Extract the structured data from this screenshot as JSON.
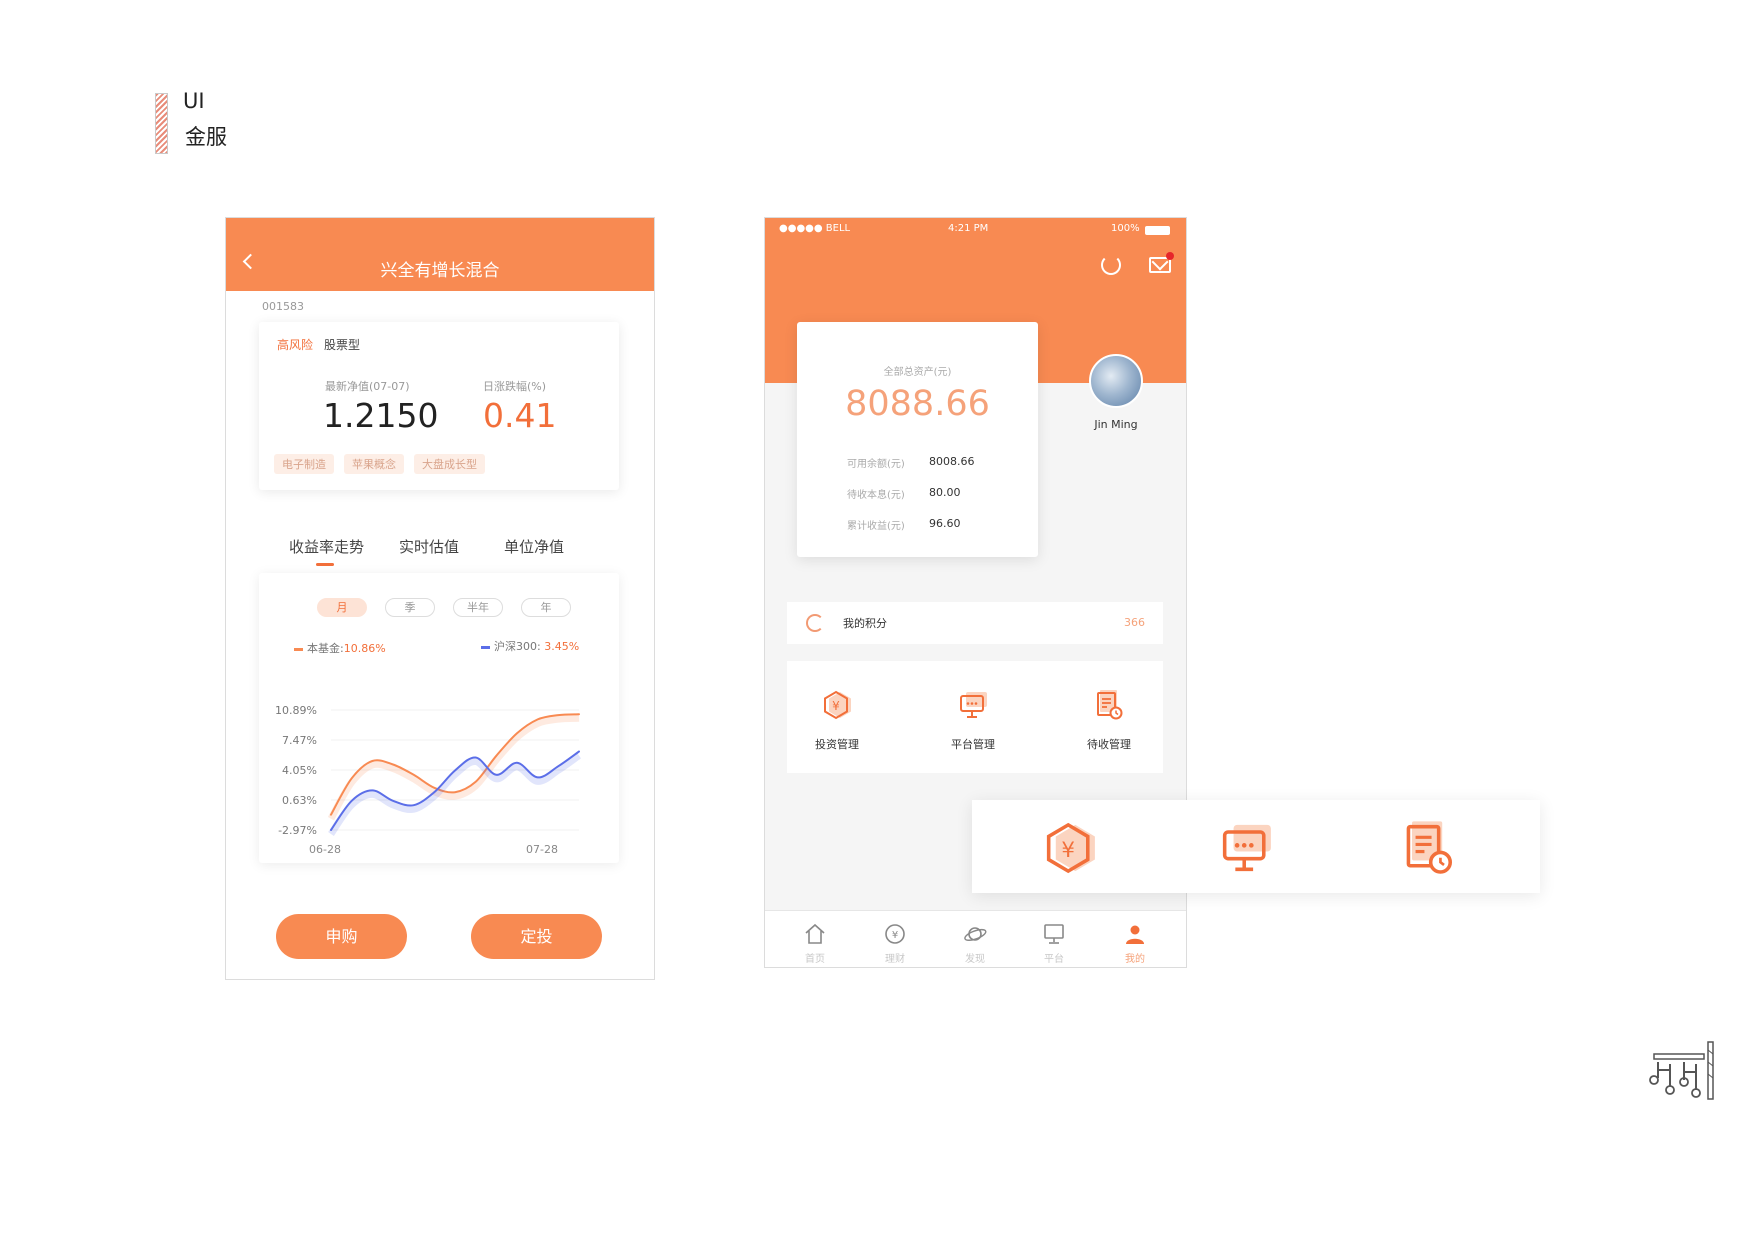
{
  "page": {
    "title": "UI",
    "subtitle": "金服"
  },
  "fund_screen": {
    "title": "兴全有增长混合",
    "fund_code": "001583",
    "risk_level": "高风险",
    "fund_type": "股票型",
    "nav_label": "最新净值(07-07)",
    "nav_value": "1.2150",
    "change_label": "日涨跌幅(%)",
    "change_value": "0.41",
    "tags": [
      "电子制造",
      "苹果概念",
      "大盘成长型"
    ],
    "tabs": [
      "收益率走势",
      "实时估值",
      "单位净值"
    ],
    "periods": [
      "月",
      "季",
      "半年",
      "年"
    ],
    "legend": {
      "fund_label": "本基金:",
      "fund_value": "10.86%",
      "index_label": "沪深300:",
      "index_value": "3.45%"
    },
    "buttons": {
      "subscribe": "申购",
      "auto_invest": "定投"
    }
  },
  "chart_data": {
    "type": "line",
    "x": [
      "06-28",
      "07-28"
    ],
    "y_ticks": [
      "10.89%",
      "7.47%",
      "4.05%",
      "0.63%",
      "-2.97%"
    ],
    "ylim": [
      -2.97,
      10.89
    ],
    "series": [
      {
        "name": "本基金",
        "color": "#f88a52",
        "values": [
          -1.2,
          3.0,
          5.0,
          4.6,
          3.4,
          1.9,
          1.4,
          2.6,
          5.6,
          8.2,
          9.8,
          10.3,
          10.4
        ]
      },
      {
        "name": "沪深300",
        "color": "#5b6ee8",
        "values": [
          -2.97,
          0.4,
          1.6,
          0.4,
          -0.1,
          1.4,
          3.9,
          5.4,
          3.4,
          4.8,
          3.1,
          4.4,
          6.1
        ]
      }
    ],
    "grid": true
  },
  "account_screen": {
    "status_bar": {
      "carrier": "●●●●● BELL",
      "time": "4:21 PM",
      "battery": "100%"
    },
    "total_asset_label": "全部总资产(元)",
    "total_asset_value": "8088.66",
    "rows": [
      {
        "label": "可用余额(元)",
        "value": "8008.66"
      },
      {
        "label": "待收本息(元)",
        "value": "80.00"
      },
      {
        "label": "累计收益(元)",
        "value": "96.60"
      }
    ],
    "user_name": "Jin Ming",
    "points_label": "我的积分",
    "points_value": "366",
    "menu": [
      "投资管理",
      "平台管理",
      "待收管理"
    ],
    "tabbar": [
      "首页",
      "理财",
      "发现",
      "平台",
      "我的"
    ],
    "colors": {
      "accent": "#f88a52",
      "accent_light": "#f5a27a",
      "notify_dot": "#e6262b"
    }
  }
}
